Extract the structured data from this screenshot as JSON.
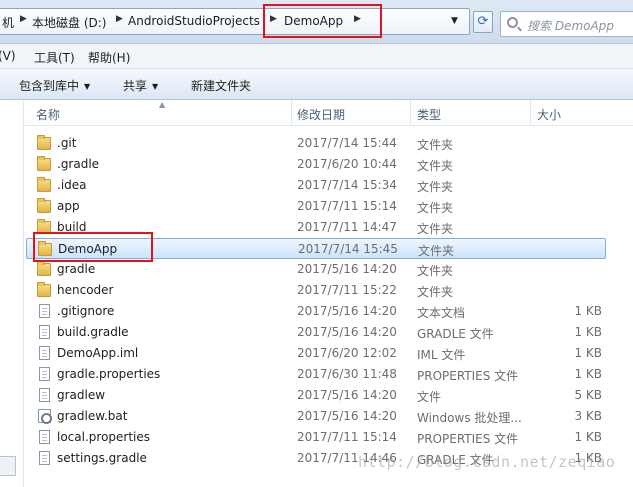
{
  "address_bar": {
    "crumbs": [
      "机",
      "本地磁盘 (D:)",
      "AndroidStudioProjects",
      "DemoApp"
    ],
    "search_placeholder": "搜索 DemoApp"
  },
  "menu": [
    "(V)",
    "工具(T)",
    "帮助(H)"
  ],
  "commands": {
    "include_library": "包含到库中",
    "share": "共享",
    "new_folder": "新建文件夹"
  },
  "columns": {
    "name": "名称",
    "date": "修改日期",
    "type": "类型",
    "size": "大小"
  },
  "files": [
    {
      "name": ".git",
      "date": "2017/7/14 15:44",
      "type": "文件夹",
      "size": "",
      "icon": "folder-icon"
    },
    {
      "name": ".gradle",
      "date": "2017/6/20 10:44",
      "type": "文件夹",
      "size": "",
      "icon": "folder-icon"
    },
    {
      "name": ".idea",
      "date": "2017/7/14 15:34",
      "type": "文件夹",
      "size": "",
      "icon": "folder-icon"
    },
    {
      "name": "app",
      "date": "2017/7/11 15:14",
      "type": "文件夹",
      "size": "",
      "icon": "folder-icon"
    },
    {
      "name": "build",
      "date": "2017/7/11 14:47",
      "type": "文件夹",
      "size": "",
      "icon": "folder-icon"
    },
    {
      "name": "DemoApp",
      "date": "2017/7/14 15:45",
      "type": "文件夹",
      "size": "",
      "icon": "folder-icon"
    },
    {
      "name": "gradle",
      "date": "2017/5/16 14:20",
      "type": "文件夹",
      "size": "",
      "icon": "folder-icon"
    },
    {
      "name": "hencoder",
      "date": "2017/7/11 15:22",
      "type": "文件夹",
      "size": "",
      "icon": "folder-icon"
    },
    {
      "name": ".gitignore",
      "date": "2017/5/16 14:20",
      "type": "文本文档",
      "size": "1 KB",
      "icon": "text-file-icon"
    },
    {
      "name": "build.gradle",
      "date": "2017/5/16 14:20",
      "type": "GRADLE 文件",
      "size": "1 KB",
      "icon": "file-icon"
    },
    {
      "name": "DemoApp.iml",
      "date": "2017/6/20 12:02",
      "type": "IML 文件",
      "size": "1 KB",
      "icon": "file-icon"
    },
    {
      "name": "gradle.properties",
      "date": "2017/6/30 11:48",
      "type": "PROPERTIES 文件",
      "size": "1 KB",
      "icon": "file-icon"
    },
    {
      "name": "gradlew",
      "date": "2017/5/16 14:20",
      "type": "文件",
      "size": "5 KB",
      "icon": "file-icon"
    },
    {
      "name": "gradlew.bat",
      "date": "2017/5/16 14:20",
      "type": "Windows 批处理...",
      "size": "3 KB",
      "icon": "batch-file-icon"
    },
    {
      "name": "local.properties",
      "date": "2017/7/11 15:14",
      "type": "PROPERTIES 文件",
      "size": "1 KB",
      "icon": "file-icon"
    },
    {
      "name": "settings.gradle",
      "date": "2017/7/11 14:46",
      "type": "GRADLE 文件",
      "size": "1 KB",
      "icon": "file-icon"
    }
  ],
  "watermark": "http://blog.csdn.net/zeqiao"
}
